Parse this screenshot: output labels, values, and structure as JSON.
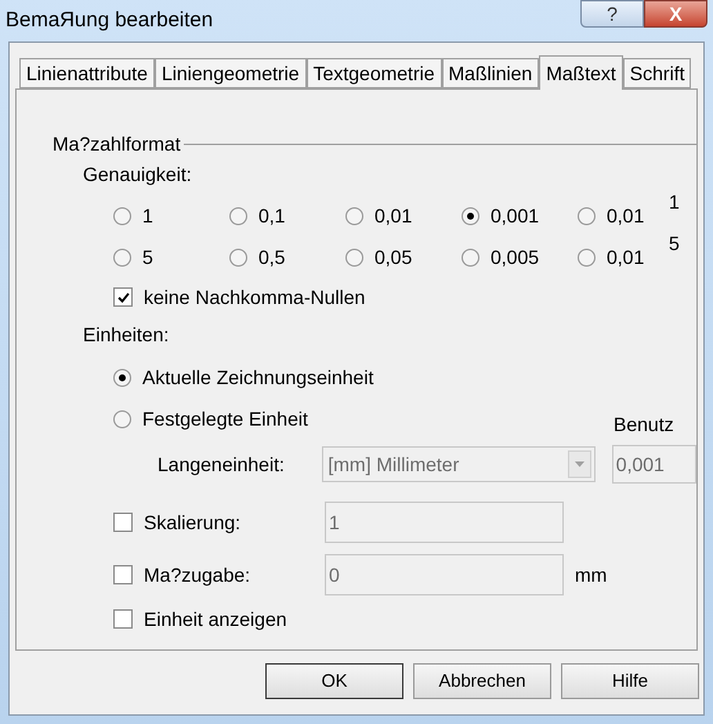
{
  "window": {
    "title": "BemaЯung bearbeiten",
    "help_button": "?",
    "close_button": "X"
  },
  "tabs": [
    {
      "label": "Linienattribute",
      "selected": false
    },
    {
      "label": "Liniengeometrie",
      "selected": false
    },
    {
      "label": "Textgeometrie",
      "selected": false
    },
    {
      "label": "Maßlinien",
      "selected": false
    },
    {
      "label": "Maßtext",
      "selected": true
    },
    {
      "label": "Schrift",
      "selected": false
    }
  ],
  "group_title": "Ma?zahlformat",
  "precision": {
    "label": "Genauigkeit:",
    "rows": [
      [
        {
          "label": "1",
          "selected": false
        },
        {
          "label": "0,1",
          "selected": false
        },
        {
          "label": "0,01",
          "selected": false
        },
        {
          "label": "0,001",
          "selected": true
        },
        {
          "label": "0,01",
          "selected": false
        }
      ],
      [
        {
          "label": "5",
          "selected": false
        },
        {
          "label": "0,5",
          "selected": false
        },
        {
          "label": "0,05",
          "selected": false
        },
        {
          "label": "0,005",
          "selected": false
        },
        {
          "label": "0,01",
          "selected": false
        }
      ]
    ],
    "row_suffixes": [
      "1",
      "5"
    ]
  },
  "no_trailing_zeros": {
    "label": "keine Nachkomma-Nullen",
    "checked": true
  },
  "units": {
    "label": "Einheiten:",
    "options": [
      {
        "label": "Aktuelle Zeichnungseinheit",
        "selected": true
      },
      {
        "label": "Festgelegte Einheit",
        "selected": false
      }
    ],
    "user_label": "Benutz",
    "length_label": "Langeneinheit:",
    "length_value": "[mm] Millimeter",
    "user_value": "0,001"
  },
  "options": [
    {
      "label": "Skalierung:",
      "checked": false,
      "value": "1"
    },
    {
      "label": "Ma?zugabe:",
      "checked": false,
      "value": "0",
      "unit": "mm"
    },
    {
      "label": "Einheit anzeigen",
      "checked": false
    }
  ],
  "buttons": [
    "OK",
    "Abbrechen",
    "Hilfe"
  ]
}
